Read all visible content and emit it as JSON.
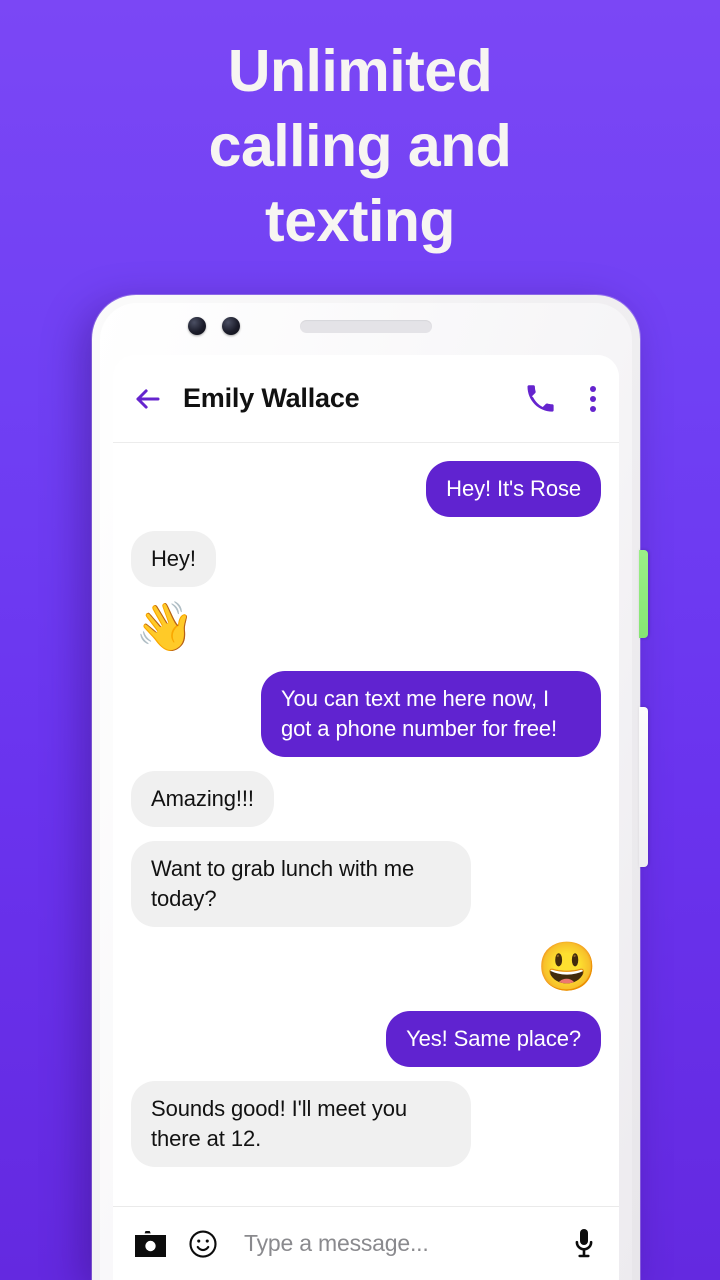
{
  "promo": {
    "headline_lines": [
      "Unlimited",
      "calling and",
      "texting"
    ],
    "background_color_top": "#7B47F5",
    "background_color_bottom": "#6429E0",
    "headline_color": "#F7F5F2"
  },
  "device": {
    "frame_color": "#F2F1F3",
    "side_button_green_color": "#8EE97A",
    "side_button_white_color": "#F6F5F7"
  },
  "chat_header": {
    "back_label": "back-arrow",
    "contact_name": "Emily Wallace",
    "call_label": "call",
    "menu_label": "more options",
    "accent_color": "#6524CE"
  },
  "conversation": {
    "outgoing_bubble_color": "#6023D0",
    "incoming_bubble_color": "#F0F0F0",
    "messages": [
      {
        "type": "text",
        "direction": "out",
        "text": "Hey! It's Rose"
      },
      {
        "type": "text",
        "direction": "in",
        "text": "Hey!"
      },
      {
        "type": "emoji",
        "direction": "in",
        "text": "👋"
      },
      {
        "type": "text",
        "direction": "out",
        "text": "You can text me here now, I got a phone number for free!"
      },
      {
        "type": "text",
        "direction": "in",
        "text": "Amazing!!!"
      },
      {
        "type": "text",
        "direction": "in",
        "text": "Want to grab lunch with me today?"
      },
      {
        "type": "emoji",
        "direction": "out",
        "text": "😃"
      },
      {
        "type": "text",
        "direction": "out",
        "text": "Yes! Same place?"
      },
      {
        "type": "text",
        "direction": "in",
        "text": "Sounds good! I'll meet you there at 12."
      }
    ]
  },
  "input_bar": {
    "camera_label": "camera",
    "emoji_label": "emoji",
    "placeholder": "Type a message...",
    "value": "",
    "mic_label": "voice message"
  }
}
